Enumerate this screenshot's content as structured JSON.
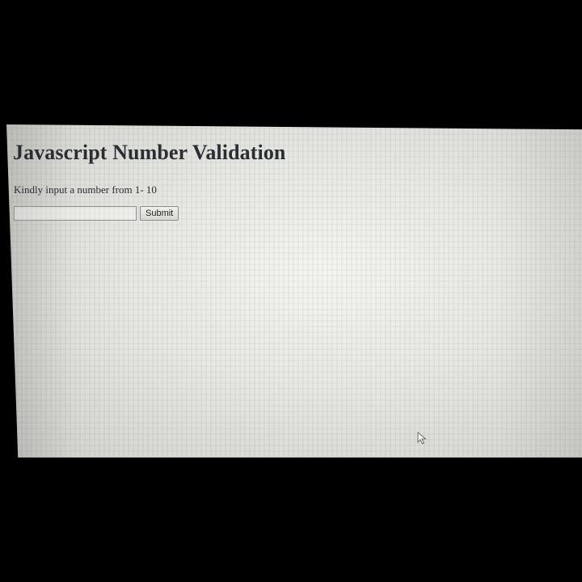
{
  "page": {
    "title": "Javascript Number Validation",
    "instruction": "Kindly input a number from 1- 10"
  },
  "form": {
    "number_input_value": "",
    "submit_label": "Submit"
  },
  "icons": {
    "cursor": "mouse-pointer-icon"
  }
}
